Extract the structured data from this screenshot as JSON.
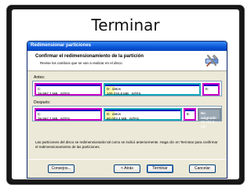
{
  "slide": {
    "title": "Terminar"
  },
  "window": {
    "title": "Redimensionar particiones",
    "header_title": "Confirmar el redimensionamiento de la partición",
    "header_subtitle": "Revise los cambios que se van a realizar en el disco.",
    "icon": "wrench-hammer-icon"
  },
  "before": {
    "label": "Antes:",
    "partitions": [
      {
        "letter": "C:",
        "size": "39.997,7 MB",
        "fs": "NTFS",
        "color": "#c800c8"
      },
      {
        "letter": "D:",
        "name": "datos",
        "size": "100.234,8 MB",
        "fs": "NTFS",
        "used_fraction": 0.1,
        "color": "#18a8b8"
      },
      {
        "letter": "E:",
        "color": "#c800c8"
      }
    ]
  },
  "after": {
    "label": "Después:",
    "partitions": [
      {
        "letter": "C:",
        "size": "39.997,7 MB",
        "fs": "NTFS",
        "color": "#c800c8"
      },
      {
        "letter": "D:",
        "name": "datos",
        "size": "80.003,4 MB",
        "fs": "NTFS",
        "used_fraction": 0.12,
        "color": "#18a8b8"
      },
      {
        "letter": "E:",
        "color": "#c800c8"
      },
      {
        "name": "No asignado",
        "size": "20.231,5 MB",
        "color": "#9aa8b4"
      }
    ]
  },
  "description": "Las particiones del disco se redimensionarán tal como se indicó anteriormente. Haga clic en Terminar para confirmar el redimensionamiento de las particiones.",
  "buttons": {
    "help": "Consejos...",
    "back": "< Atrás",
    "finish": "Terminar",
    "cancel": "Cancelar"
  }
}
